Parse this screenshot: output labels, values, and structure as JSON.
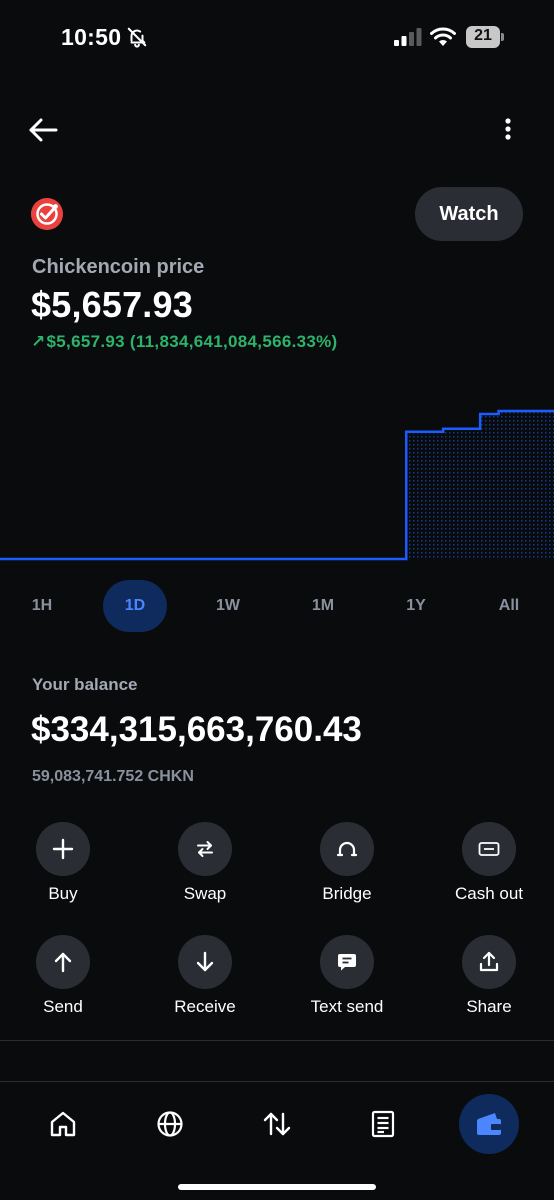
{
  "status_bar": {
    "time": "10:50",
    "battery_level": "21",
    "icons": [
      "bell-off-icon",
      "signal-icon",
      "wifi-icon",
      "battery-icon"
    ]
  },
  "header": {
    "back_icon": "back-arrow-icon",
    "more_icon": "more-vertical-icon",
    "watch_label": "Watch"
  },
  "asset": {
    "logo_icon": "chickencoin-logo",
    "price_label": "Chickencoin price",
    "price": "$5,657.93",
    "change": "$5,657.93 (11,834,641,084,566.33%)",
    "change_direction_icon": "arrow-up-right-icon"
  },
  "colors": {
    "background": "#0a0b0d",
    "accent": "#1a5cff",
    "positive": "#2db36b",
    "chart_line": "#1a5cff",
    "button_bg": "#2a2d33",
    "active_tab_bg": "#0f2a5c"
  },
  "chart": {
    "type": "line",
    "y_values": [
      0,
      0,
      0,
      0,
      0,
      0,
      0,
      0,
      0,
      0,
      0,
      0,
      0,
      0,
      0,
      0,
      0,
      0,
      0,
      0,
      0,
      0,
      0.86,
      0.86,
      0.88,
      0.88,
      0.98,
      1.0,
      1.0,
      1.0,
      1.0
    ]
  },
  "range_tabs": [
    {
      "label": "1H",
      "active": false
    },
    {
      "label": "1D",
      "active": true
    },
    {
      "label": "1W",
      "active": false
    },
    {
      "label": "1M",
      "active": false
    },
    {
      "label": "1Y",
      "active": false
    },
    {
      "label": "All",
      "active": false
    }
  ],
  "balance": {
    "label": "Your balance",
    "value": "$334,315,663,760.43",
    "amount": "59,083,741.752 CHKN"
  },
  "actions": [
    {
      "label": "Buy",
      "icon": "plus-icon"
    },
    {
      "label": "Swap",
      "icon": "swap-icon"
    },
    {
      "label": "Bridge",
      "icon": "bridge-icon"
    },
    {
      "label": "Cash out",
      "icon": "cash-out-icon"
    },
    {
      "label": "Send",
      "icon": "arrow-up-icon"
    },
    {
      "label": "Receive",
      "icon": "arrow-down-icon"
    },
    {
      "label": "Text send",
      "icon": "message-icon"
    },
    {
      "label": "Share",
      "icon": "share-icon"
    }
  ],
  "bottom_nav": [
    {
      "name": "home",
      "icon": "home-icon",
      "active": false
    },
    {
      "name": "explore",
      "icon": "globe-icon",
      "active": false
    },
    {
      "name": "trade",
      "icon": "transfer-icon",
      "active": false
    },
    {
      "name": "activity",
      "icon": "document-icon",
      "active": false
    },
    {
      "name": "wallet",
      "icon": "wallet-icon",
      "active": true
    }
  ]
}
